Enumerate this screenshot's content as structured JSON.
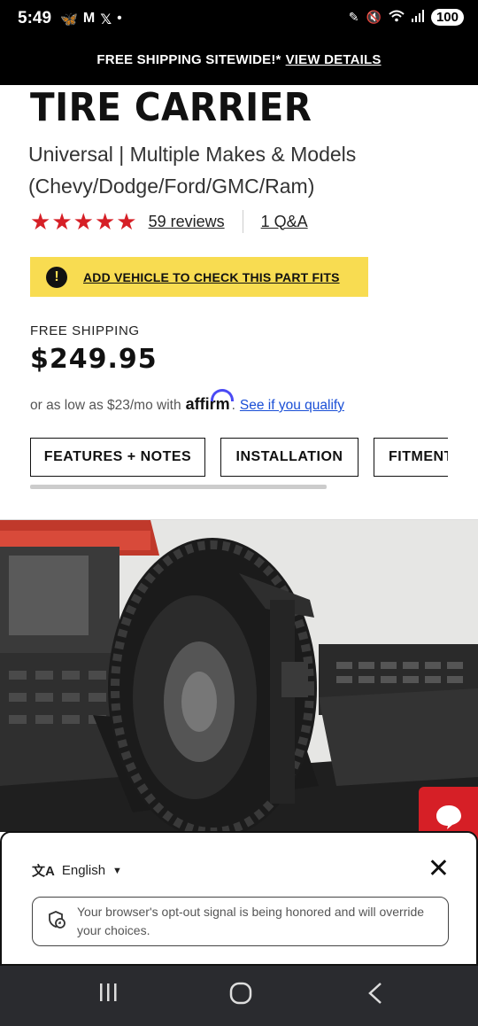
{
  "status_bar": {
    "time": "5:49",
    "battery": "100",
    "left_icons": [
      "butterfly-icon",
      "gmail-icon",
      "x-icon",
      "dot"
    ],
    "right_icons": [
      "pen-icon",
      "mute-icon",
      "wifi-icon",
      "signal-icon"
    ]
  },
  "promo": {
    "text": "FREE SHIPPING SITEWIDE!*",
    "link": "VIEW DETAILS"
  },
  "product": {
    "title": "TIRE CARRIER",
    "subtitle": "Universal | Multiple Makes & Models (Chevy/Dodge/Ford/GMC/Ram)",
    "rating": 5,
    "reviews": "59 reviews",
    "qa": "1 Q&A"
  },
  "fitment": {
    "text": "ADD VEHICLE TO CHECK THIS PART FITS"
  },
  "pricing": {
    "shipping": "FREE SHIPPING",
    "price": "$249.95",
    "financing_prefix": "or as low as $23/mo with",
    "affirm": "affirm",
    "financing_period": ".",
    "financing_link": "See if you qualify"
  },
  "tabs": [
    {
      "label": "FEATURES + NOTES"
    },
    {
      "label": "INSTALLATION"
    },
    {
      "label": "FITMENT"
    }
  ],
  "consent": {
    "language": "English",
    "notice": "Your browser's opt-out signal is being honored and will override your choices."
  },
  "colors": {
    "accent_red": "#d61f26",
    "fit_yellow": "#f8dc51",
    "link_blue": "#1a4fd6",
    "affirm_blue": "#4a4af4"
  }
}
